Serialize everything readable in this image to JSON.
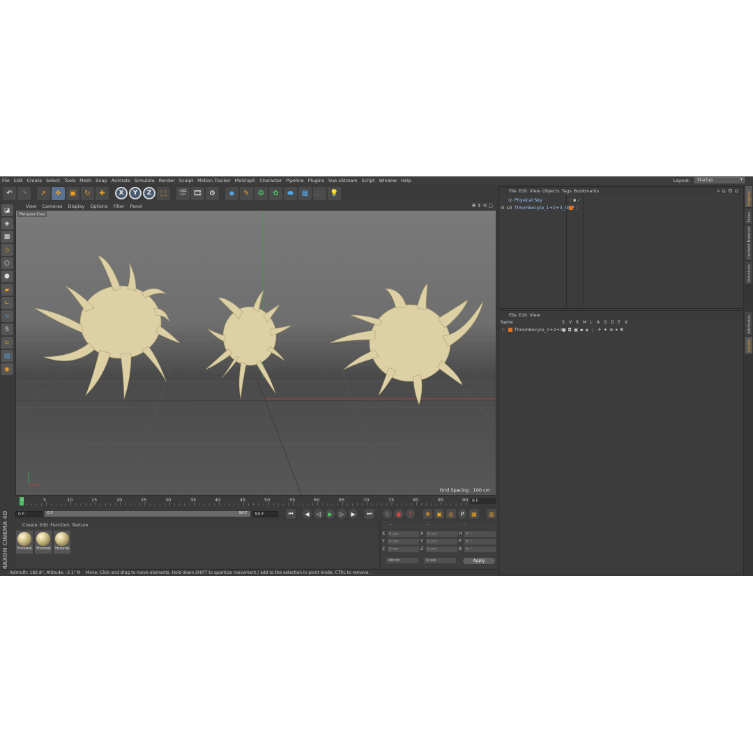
{
  "menubar": {
    "items": [
      "File",
      "Edit",
      "Create",
      "Select",
      "Tools",
      "Mesh",
      "Snap",
      "Animate",
      "Simulate",
      "Render",
      "Sculpt",
      "Motion Tracker",
      "MoGraph",
      "Character",
      "Pipeline",
      "Plugins",
      "Vue xStream",
      "Script",
      "Window",
      "Help"
    ],
    "layout_label": "Layout:",
    "layout_value": "Startup"
  },
  "viewport": {
    "menu": [
      "View",
      "Cameras",
      "Display",
      "Options",
      "Filter",
      "Panel"
    ],
    "label": "Perspective",
    "grid_spacing": "Grid Spacing : 100 cm"
  },
  "timeline": {
    "ticks": [
      "0",
      "5",
      "10",
      "15",
      "20",
      "25",
      "30",
      "35",
      "40",
      "45",
      "50",
      "55",
      "60",
      "65",
      "70",
      "75",
      "80",
      "85",
      "90"
    ],
    "end_field": "0 F",
    "current_frame": "0 F",
    "range_start": "0 F",
    "range_end": "90 F",
    "max_frame": "90 F"
  },
  "materials": {
    "menu": [
      "Create",
      "Edit",
      "Function",
      "Texture"
    ],
    "items": [
      "Thromb",
      "Thromb",
      "Thromb"
    ]
  },
  "coordinates": {
    "headers": [
      "--",
      "--",
      "--"
    ],
    "rows": [
      {
        "a": "X",
        "av": "0 cm",
        "b": "X",
        "bv": "0 cm",
        "c": "H",
        "cv": "0 °"
      },
      {
        "a": "Y",
        "av": "0 cm",
        "b": "Y",
        "bv": "0 cm",
        "c": "P",
        "cv": "0 °"
      },
      {
        "a": "Z",
        "av": "0 cm",
        "b": "Z",
        "bv": "0 cm",
        "c": "B",
        "cv": "0 °"
      }
    ],
    "world": "World",
    "scale": "Scale",
    "apply": "Apply"
  },
  "status": {
    "angles": "Azimuth: 182.8°, Altitude: -3.1°  N",
    "hint": "Move: Click and drag to move elements. Hold down SHIFT to quantize movement / add to the selection in point mode, CTRL to remove."
  },
  "objects": {
    "menu": [
      "File",
      "Edit",
      "View",
      "Objects",
      "Tags",
      "Bookmarks"
    ],
    "rows": [
      "Physical Sky",
      "Thrombocyte_1+2+3_GRP"
    ]
  },
  "layers": {
    "menu": [
      "File",
      "Edit",
      "View"
    ],
    "name_header": "Name",
    "flags": [
      "S",
      "V",
      "R",
      "M",
      "L",
      "A",
      "G",
      "D",
      "E",
      "X"
    ],
    "row": "Thrombocyte_1+2+3"
  },
  "right_tabs": [
    "Objects",
    "Takes",
    "Content Browser",
    "Structure",
    "Attributes",
    "Layers"
  ],
  "brand": "MAXON CINEMA 4D",
  "colors": {
    "accent_orange": "#f0a020",
    "layer_color": "#e07020",
    "object_blob": "#dcd0a4"
  }
}
